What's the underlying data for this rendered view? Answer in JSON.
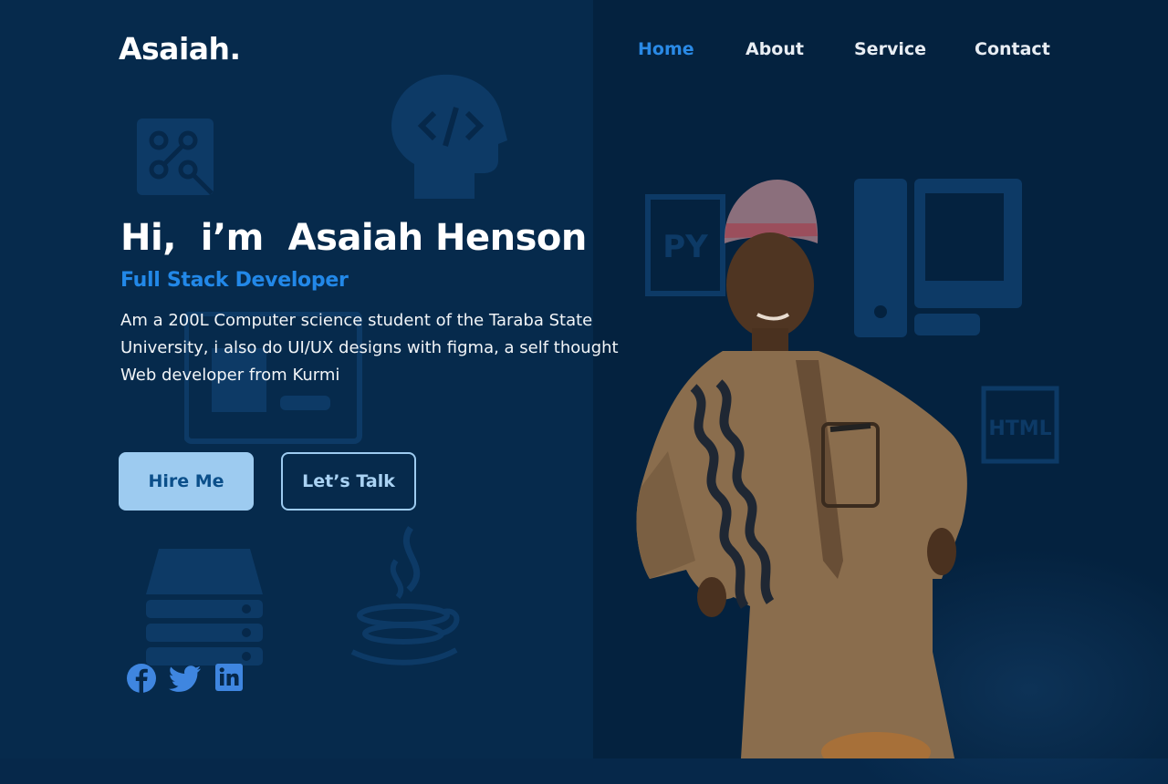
{
  "brand": {
    "logo": "Asaiah."
  },
  "nav": {
    "items": [
      {
        "label": "Home",
        "active": true
      },
      {
        "label": "About",
        "active": false
      },
      {
        "label": "Service",
        "active": false
      },
      {
        "label": "Contact",
        "active": false
      }
    ]
  },
  "hero": {
    "title": "Hi,  i’m  Asaiah Henson",
    "subtitle": "Full Stack Developer",
    "description": "Am a 200L Computer science student of the Taraba State University, i also do UI/UX designs with figma, a self thought Web developer from Kurmi"
  },
  "buttons": {
    "hire_label": "Hire Me",
    "talk_label": "Let’s Talk"
  },
  "social": {
    "icons": [
      "facebook-icon",
      "twitter-icon",
      "linkedin-icon"
    ]
  },
  "background": {
    "icons": [
      "python-file-icon",
      "html-file-icon",
      "code-head-icon",
      "desktop-computer-icon",
      "server-icon",
      "java-icon",
      "circuit-icon",
      "browser-window-icon"
    ],
    "py_text": "PY",
    "html_text": "HTML"
  },
  "colors": {
    "background": "#06284a",
    "accent": "#2a8ae6",
    "button_fill": "#9dcbf0",
    "icon_blue": "#3f86e0"
  }
}
